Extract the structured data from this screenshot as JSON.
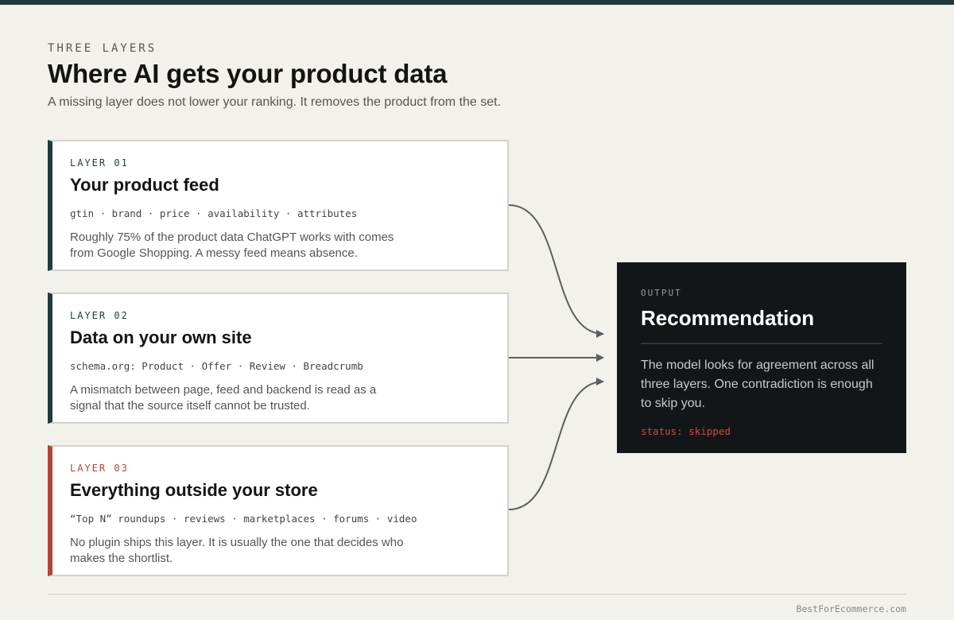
{
  "header": {
    "eyebrow": "THREE LAYERS",
    "title": "Where AI gets your product data",
    "subtitle": "A missing layer does not lower your ranking. It removes the product from the set."
  },
  "layers": [
    {
      "label": "LAYER 01",
      "heading": "Your product feed",
      "tags": "gtin · brand · price · availability · attributes",
      "description": "Roughly 75% of the product data ChatGPT works with comes from Google Shopping. A messy feed means absence."
    },
    {
      "label": "LAYER 02",
      "heading": "Data on your own site",
      "tags": "schema.org: Product · Offer · Review · Breadcrumb",
      "description": "A mismatch between page, feed and backend is read as a signal that the source itself cannot be trusted."
    },
    {
      "label": "LAYER 03",
      "heading": "Everything outside your store",
      "tags": "“Top N” roundups · reviews · marketplaces · forums · video",
      "description": "No plugin ships this layer. It is usually the one that decides who makes the shortlist."
    }
  ],
  "output": {
    "label": "OUTPUT",
    "title": "Recommendation",
    "description": "The model looks for agreement across all three layers. One contradiction is enough to skip you.",
    "status": "status: skipped"
  },
  "footer": {
    "credit": "BestForEcommerce.com"
  },
  "colors": {
    "accent_dark": "#1f3b3a",
    "accent_alert": "#b24632",
    "output_bg": "#131619",
    "status_red": "#d04a38",
    "connector": "#5a5f63"
  }
}
